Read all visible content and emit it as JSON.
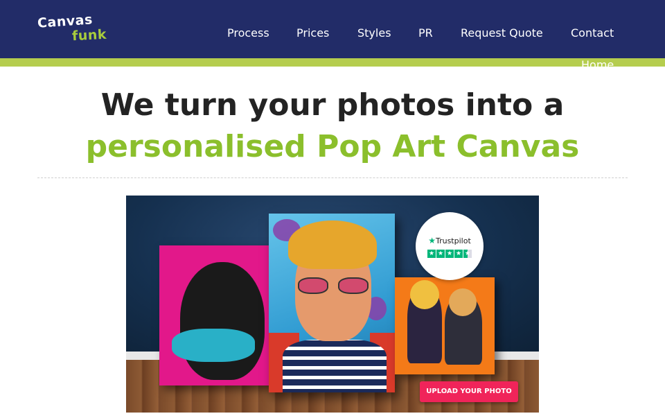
{
  "brand": {
    "logo_line1": "Canvas",
    "logo_line2": "funk"
  },
  "nav": {
    "items": [
      {
        "label": "Process"
      },
      {
        "label": "Prices"
      },
      {
        "label": "Styles"
      },
      {
        "label": "PR"
      },
      {
        "label": "Request Quote"
      },
      {
        "label": "Contact"
      },
      {
        "label": "Home"
      }
    ]
  },
  "hero": {
    "title_line1": "We turn your photos into a",
    "title_line2": "personalised Pop Art Canvas",
    "trustpilot_label": "Trustpilot",
    "trustpilot_stars": 4.5,
    "upload_button": "UPLOAD YOUR PHOTO"
  },
  "colors": {
    "header_bg": "#222c68",
    "accent_stripe": "#b5cd4e",
    "highlight_green": "#8bbf2c",
    "upload_button": "#f0245a",
    "trustpilot_green": "#00b67a"
  }
}
